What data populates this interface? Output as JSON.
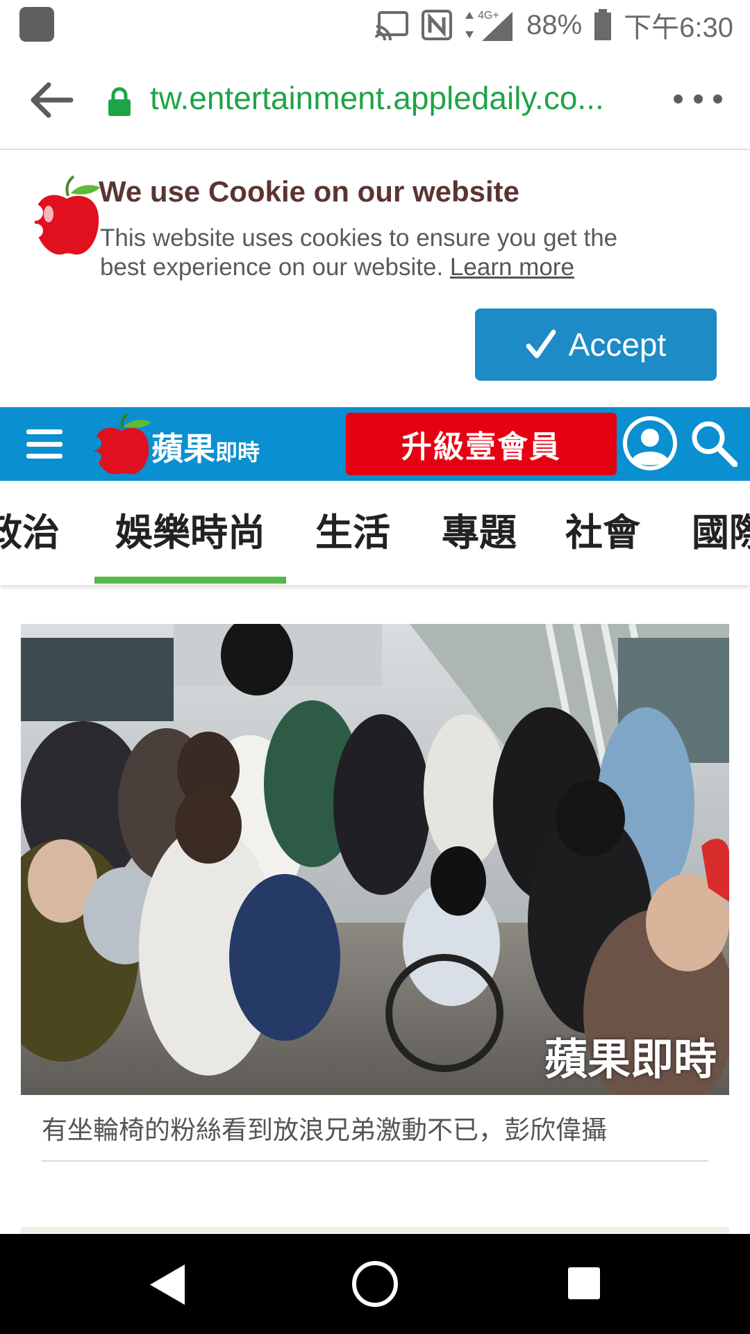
{
  "status_bar": {
    "network": "4G+",
    "battery": "88%",
    "time": "下午6:30"
  },
  "browser": {
    "url": "tw.entertainment.appledaily.co...",
    "back_icon": "arrow-left-icon",
    "lock_icon": "lock-icon",
    "menu_icon": "more-dots-icon"
  },
  "cookie_banner": {
    "title": "We use Cookie on our website",
    "body": "This website uses cookies to ensure you get the best experience on our website.",
    "learn_more": "Learn more",
    "accept_label": "Accept",
    "accept_color": "#1c8bc6"
  },
  "site_header": {
    "brand_main": "蘋果",
    "brand_sub": "即時",
    "upgrade_label": "升級壹會員",
    "header_color": "#0a8fd0",
    "upgrade_color": "#e50012"
  },
  "category_tabs": [
    {
      "label": "政治"
    },
    {
      "label": "娛樂時尚",
      "selected": true
    },
    {
      "label": "生活"
    },
    {
      "label": "專題"
    },
    {
      "label": "社會"
    },
    {
      "label": "國際"
    }
  ],
  "article": {
    "photo_watermark": "蘋果即時",
    "caption": "有坐輪椅的粉絲看到放浪兄弟激動不已，彭欣偉攝"
  },
  "nav_bar": {
    "back_icon": "nav-back-icon",
    "home_icon": "nav-home-icon",
    "recents_icon": "nav-recents-icon"
  }
}
